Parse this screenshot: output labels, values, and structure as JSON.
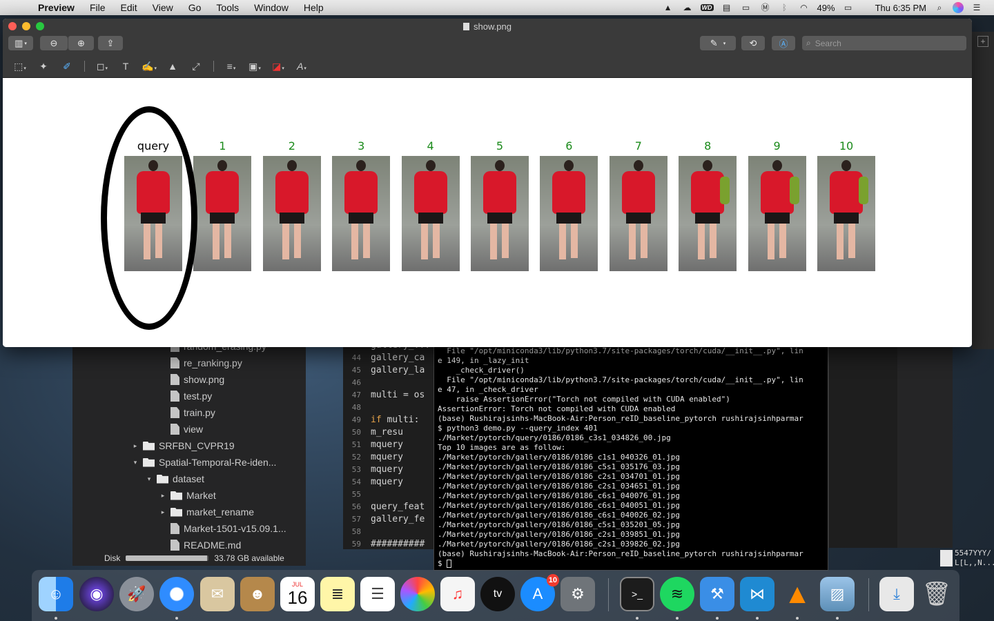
{
  "menubar": {
    "app_name": "Preview",
    "menus": [
      "File",
      "Edit",
      "View",
      "Go",
      "Tools",
      "Window",
      "Help"
    ],
    "battery": "49%",
    "clock": "Thu 6:35 PM"
  },
  "preview_window": {
    "title": "show.png",
    "search_placeholder": "Search",
    "labels": [
      "query",
      "1",
      "2",
      "3",
      "4",
      "5",
      "6",
      "7",
      "8",
      "9",
      "10"
    ],
    "colors": {
      "query_label": "#000000",
      "rank_label": "#1a8a1a",
      "circle": "#000000"
    }
  },
  "explorer": {
    "items": [
      {
        "type": "file",
        "label": "random_erasing.py"
      },
      {
        "type": "file",
        "label": "re_ranking.py"
      },
      {
        "type": "file",
        "label": "show.png"
      },
      {
        "type": "file",
        "label": "test.py"
      },
      {
        "type": "file",
        "label": "train.py"
      },
      {
        "type": "file",
        "label": "view"
      },
      {
        "type": "folder",
        "label": "SRFBN_CVPR19",
        "expanded": false
      },
      {
        "type": "folder",
        "label": "Spatial-Temporal-Re-iden...",
        "expanded": true
      },
      {
        "type": "folder",
        "label": "dataset",
        "expanded": true
      },
      {
        "type": "folder",
        "label": "Market",
        "expanded": false
      },
      {
        "type": "folder",
        "label": "market_rename",
        "expanded": false
      },
      {
        "type": "file",
        "label": "Market-1501-v15.09.1..."
      },
      {
        "type": "file",
        "label": "README.md"
      }
    ],
    "disk_label": "Disk",
    "disk_available": "33.78 GB available"
  },
  "editor": {
    "lines": [
      {
        "num": "",
        "text": "gallery_..."
      },
      {
        "num": "44",
        "text": "gallery_ca"
      },
      {
        "num": "45",
        "text": "gallery_la"
      },
      {
        "num": "46",
        "text": ""
      },
      {
        "num": "47",
        "text": "multi = os"
      },
      {
        "num": "48",
        "text": ""
      },
      {
        "num": "49",
        "kw": "if",
        "text": " multi:"
      },
      {
        "num": "50",
        "text": "    m_resu"
      },
      {
        "num": "51",
        "text": "    mquery"
      },
      {
        "num": "52",
        "text": "    mquery"
      },
      {
        "num": "53",
        "text": "    mquery"
      },
      {
        "num": "54",
        "text": "    mquery"
      },
      {
        "num": "55",
        "text": ""
      },
      {
        "num": "56",
        "text": "query_feat"
      },
      {
        "num": "57",
        "text": "gallery_fe"
      },
      {
        "num": "58",
        "text": ""
      },
      {
        "num": "59",
        "text": "##########"
      }
    ]
  },
  "terminal": {
    "lines": [
      "  File \"/opt/miniconda3/lib/python3.7/site-packages/torch/cuda/__init__.py\", lin",
      "e 149, in _lazy_init",
      "    _check_driver()",
      "  File \"/opt/miniconda3/lib/python3.7/site-packages/torch/cuda/__init__.py\", lin",
      "e 47, in _check_driver",
      "    raise AssertionError(\"Torch not compiled with CUDA enabled\")",
      "AssertionError: Torch not compiled with CUDA enabled",
      "(base) Rushirajsinhs-MacBook-Air:Person_reID_baseline_pytorch rushirajsinhparmar",
      "$ python3 demo.py --query_index 401",
      "./Market/pytorch/query/0186/0186_c3s1_034826_00.jpg",
      "Top 10 images are as follow:",
      "./Market/pytorch/gallery/0186/0186_c1s1_040326_01.jpg",
      "./Market/pytorch/gallery/0186/0186_c5s1_035176_03.jpg",
      "./Market/pytorch/gallery/0186/0186_c2s1_034701_01.jpg",
      "./Market/pytorch/gallery/0186/0186_c2s1_034651_01.jpg",
      "./Market/pytorch/gallery/0186/0186_c6s1_040076_01.jpg",
      "./Market/pytorch/gallery/0186/0186_c6s1_040051_01.jpg",
      "./Market/pytorch/gallery/0186/0186_c6s1_040026_02.jpg",
      "./Market/pytorch/gallery/0186/0186_c5s1_035201_05.jpg",
      "./Market/pytorch/gallery/0186/0186_c2s1_039851_01.jpg",
      "./Market/pytorch/gallery/0186/0186_c2s1_039826_02.jpg",
      "(base) Rushirajsinhs-MacBook-Air:Person_reID_baseline_pytorch rushirajsinhparmar",
      "$ "
    ]
  },
  "background_text": {
    "right_fragment_1": "5547YYY/",
    "right_fragment_2": "L[L,,N...W"
  },
  "dock": {
    "calendar_month": "JUL",
    "calendar_day": "16",
    "app_store_badge": "10",
    "apps": [
      "finder-icon",
      "siri-icon",
      "launchpad-icon",
      "safari-icon",
      "mail-icon",
      "contacts-icon",
      "calendar-icon",
      "notes-icon",
      "reminders-icon",
      "photos-icon",
      "music-icon",
      "apple-tv-icon",
      "app-store-icon",
      "system-preferences-icon",
      "terminal-icon",
      "spotify-icon",
      "xcode-icon",
      "vscode-icon",
      "vlc-icon",
      "preview-icon",
      "downloads-icon",
      "trash-icon"
    ],
    "appletv_label": "tv"
  }
}
